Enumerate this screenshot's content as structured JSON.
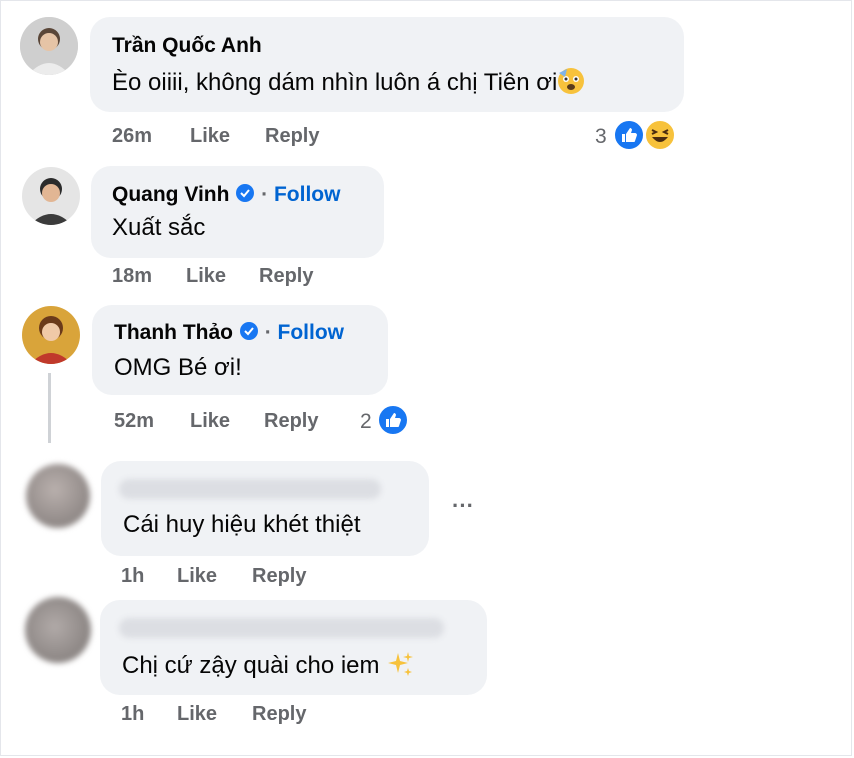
{
  "comments": [
    {
      "name": "Trần Quốc Anh",
      "text": "Èo oiiii, không dám nhìn luôn á chị Tiên ơi",
      "time": "26m",
      "like": "Like",
      "reply": "Reply",
      "reaction_count": "3"
    },
    {
      "name": "Quang Vinh",
      "follow": "Follow",
      "separator": "·",
      "text": "Xuất sắc",
      "time": "18m",
      "like": "Like",
      "reply": "Reply"
    },
    {
      "name": "Thanh Thảo",
      "follow": "Follow",
      "separator": "·",
      "text": "OMG Bé ơi!",
      "time": "52m",
      "like": "Like",
      "reply": "Reply",
      "reaction_count": "2"
    },
    {
      "text": "Cái huy hiệu khét thiệt",
      "time": "1h",
      "like": "Like",
      "reply": "Reply",
      "more": "···"
    },
    {
      "text": "Chị cứ zậy quài cho iem ",
      "time": "1h",
      "like": "Like",
      "reply": "Reply"
    }
  ],
  "colors": {
    "bubble": "#f0f2f5",
    "link": "#0064d1",
    "meta": "#65676b",
    "like_blue": "#1877f2"
  }
}
